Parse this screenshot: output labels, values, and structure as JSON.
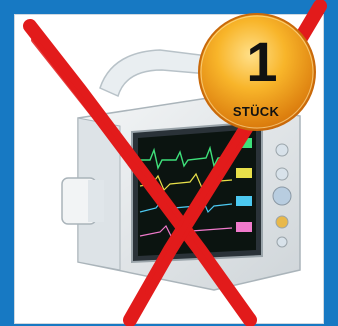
{
  "badge": {
    "number": "1",
    "label": "STÜCK",
    "color": "#f5a21a"
  },
  "overlay": {
    "cross_color": "#e21b1b"
  },
  "frame": {
    "border_color": "#1779c3"
  },
  "product": {
    "icon": "patient-monitor-icon"
  }
}
